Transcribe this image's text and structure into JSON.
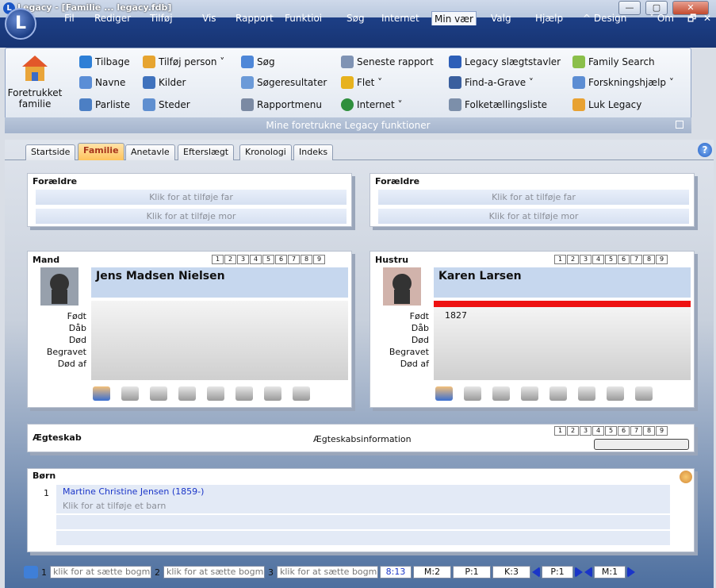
{
  "window": {
    "title": "Legacy - [Familie ... legacy.fdb]",
    "app_letter": "L",
    "min": "—",
    "max": "▢",
    "close": "✕"
  },
  "menu": {
    "items": [
      "Fil",
      "Rediger",
      "Tilføj",
      "Vis",
      "Rapport",
      "Funktioi",
      "Søg",
      "Internet",
      "Min vær",
      "Valg",
      "Hjælp",
      "^ Design",
      "˅ Om",
      "🗗",
      "✕"
    ],
    "active_index": 8
  },
  "ribbon": {
    "home_label": "Foretrukket familie",
    "caption": "Mine foretrukne Legacy funktioner",
    "col1": [
      "Tilbage",
      "Navne",
      "Parliste"
    ],
    "col2": [
      "Tilføj person ˅",
      "Kilder",
      "Steder"
    ],
    "col3": [
      "Søg",
      "Søgeresultater",
      "Rapportmenu"
    ],
    "col4": [
      "Seneste rapport",
      "Flet ˅",
      "Internet ˅"
    ],
    "col5": [
      "Legacy slægtstavler",
      "Find-a-Grave ˅",
      "Folketællingsliste"
    ],
    "col6": [
      "Family Search",
      "Forskningshjælp ˅",
      "Luk Legacy"
    ]
  },
  "tabs": [
    "Startside",
    "Familie",
    "Anetavle",
    "Efterslægt",
    "Kronologi",
    "Indeks"
  ],
  "active_tab": 1,
  "parents_left": {
    "title": "Forældre",
    "father": "Klik for at tilføje far",
    "mother": "Klik for at tilføje mor"
  },
  "parents_right": {
    "title": "Forældre",
    "father": "Klik for at tilføje far",
    "mother": "Klik for at tilføje mor"
  },
  "numbers": [
    "1",
    "2",
    "3",
    "4",
    "5",
    "6",
    "7",
    "8",
    "9"
  ],
  "husband": {
    "title": "Mand",
    "name": "Jens Madsen Nielsen",
    "born": "",
    "fields": {
      "born": "Født",
      "bapt": "Dåb",
      "died": "Død",
      "buried": "Begravet",
      "cause": "Død af"
    }
  },
  "wife": {
    "title": "Hustru",
    "name": "Karen Larsen",
    "born": "1827",
    "fields": {
      "born": "Født",
      "bapt": "Dåb",
      "died": "Død",
      "buried": "Begravet",
      "cause": "Død af"
    }
  },
  "marriage": {
    "title": "Ægteskab",
    "info": "Ægteskabsinformation"
  },
  "children": {
    "title": "Børn",
    "items": [
      {
        "num": "1",
        "name": "Martine Christine Jensen (1859-)"
      }
    ],
    "add_label": "Klik for at tilføje et barn"
  },
  "status": {
    "bookmarks": [
      {
        "n": "1",
        "label": "klik for at sætte bogm"
      },
      {
        "n": "2",
        "label": "klik for at sætte bogm"
      },
      {
        "n": "3",
        "label": "klik for at sætte bogm"
      }
    ],
    "time": "8:13",
    "m": "M:2",
    "p": "P:1",
    "k": "K:3",
    "p2": "P:1",
    "m2": "M:1"
  },
  "colors": {
    "accent_menu": "#1d3f86",
    "wife_bar": "#ee1111",
    "child_link": "#1a35c8"
  }
}
